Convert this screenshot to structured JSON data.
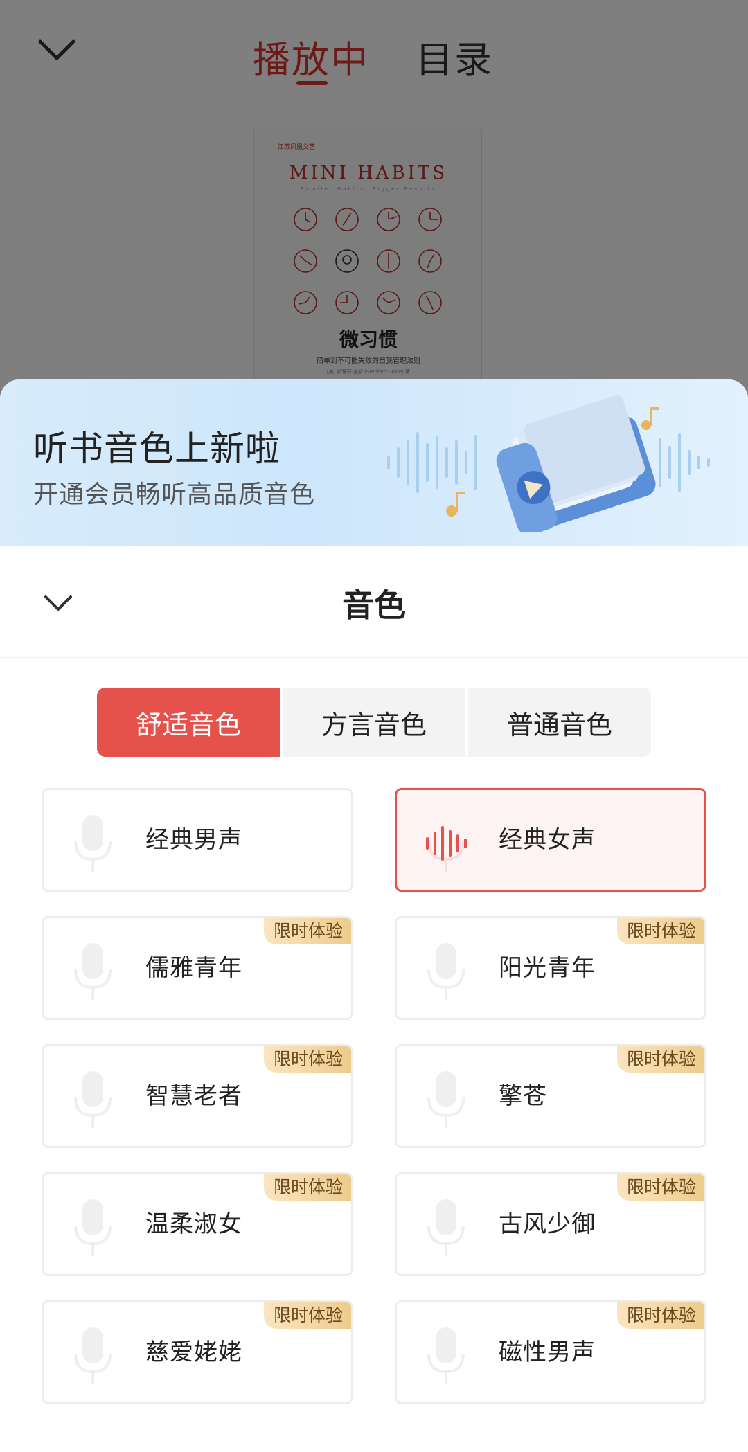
{
  "player": {
    "tabs": [
      {
        "label": "播放中",
        "active": true
      },
      {
        "label": "目录",
        "active": false
      }
    ],
    "cover": {
      "publisher": "江苏凤凰文艺",
      "title_en": "MINI HABITS",
      "subtitle_en": "Smaller Habits, Bigger Results",
      "title_cn": "微习惯",
      "tagline": "简单到不可能失败的自我管理法则",
      "author": "[美] 斯蒂芬·盖斯 (Stephen Guise) 著"
    }
  },
  "promo": {
    "title": "听书音色上新啦",
    "subtitle": "开通会员畅听高品质音色"
  },
  "sheet": {
    "title": "音色",
    "segments": [
      {
        "label": "舒适音色",
        "active": true
      },
      {
        "label": "方言音色",
        "active": false
      },
      {
        "label": "普通音色",
        "active": false
      }
    ],
    "voices": [
      {
        "label": "经典男声",
        "badge": "",
        "selected": false
      },
      {
        "label": "经典女声",
        "badge": "",
        "selected": true
      },
      {
        "label": "儒雅青年",
        "badge": "限时体验",
        "selected": false
      },
      {
        "label": "阳光青年",
        "badge": "限时体验",
        "selected": false
      },
      {
        "label": "智慧老者",
        "badge": "限时体验",
        "selected": false
      },
      {
        "label": "擎苍",
        "badge": "限时体验",
        "selected": false
      },
      {
        "label": "温柔淑女",
        "badge": "限时体验",
        "selected": false
      },
      {
        "label": "古风少御",
        "badge": "限时体验",
        "selected": false
      },
      {
        "label": "慈爱姥姥",
        "badge": "限时体验",
        "selected": false
      },
      {
        "label": "磁性男声",
        "badge": "限时体验",
        "selected": false
      }
    ]
  },
  "colors": {
    "accent": "#e5514b",
    "badge_gold": "#eecb8d"
  },
  "icons": {
    "back": "chevron-down-icon",
    "voice": "microphone-icon",
    "selected_voice": "sound-wave-icon"
  }
}
